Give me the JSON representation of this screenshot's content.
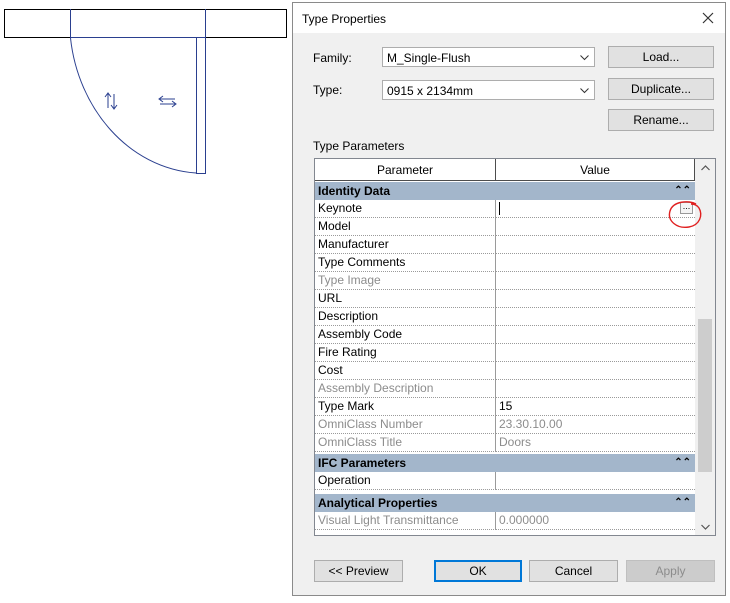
{
  "dialog": {
    "title": "Type Properties",
    "family_label": "Family:",
    "family_value": "M_Single-Flush",
    "type_label": "Type:",
    "type_value": "0915 x 2134mm",
    "load_label": "Load...",
    "duplicate_label": "Duplicate...",
    "rename_label": "Rename...",
    "type_parameters_label": "Type Parameters",
    "grid": {
      "header_parameter": "Parameter",
      "header_value": "Value",
      "groups": {
        "identity": "Identity Data",
        "ifc": "IFC Parameters",
        "analytical": "Analytical Properties"
      },
      "rows": {
        "keynote": {
          "name": "Keynote",
          "value": ""
        },
        "model": {
          "name": "Model",
          "value": ""
        },
        "manufacturer": {
          "name": "Manufacturer",
          "value": ""
        },
        "type_comments": {
          "name": "Type Comments",
          "value": ""
        },
        "type_image": {
          "name": "Type Image",
          "value": ""
        },
        "url": {
          "name": "URL",
          "value": ""
        },
        "description": {
          "name": "Description",
          "value": ""
        },
        "assembly_code": {
          "name": "Assembly Code",
          "value": ""
        },
        "fire_rating": {
          "name": "Fire Rating",
          "value": ""
        },
        "cost": {
          "name": "Cost",
          "value": ""
        },
        "assembly_description": {
          "name": "Assembly Description",
          "value": ""
        },
        "type_mark": {
          "name": "Type Mark",
          "value": "15"
        },
        "omniclass_number": {
          "name": "OmniClass Number",
          "value": "23.30.10.00"
        },
        "omniclass_title": {
          "name": "OmniClass Title",
          "value": "Doors"
        },
        "operation": {
          "name": "Operation",
          "value": ""
        },
        "visual_light": {
          "name": "Visual Light Transmittance",
          "value": "0.000000"
        }
      },
      "browse_label": "..."
    },
    "buttons": {
      "preview": "<< Preview",
      "ok": "OK",
      "cancel": "Cancel",
      "apply": "Apply"
    }
  },
  "colors": {
    "group_header": "#a3b6cb",
    "annotation_circle": "#e02020",
    "door_lines": "#2a3f8f"
  },
  "icons": [
    "close-icon",
    "dropdown-arrow-icon",
    "collapse-icon",
    "scroll-up-icon",
    "scroll-down-icon",
    "flip-arrow-icon"
  ]
}
